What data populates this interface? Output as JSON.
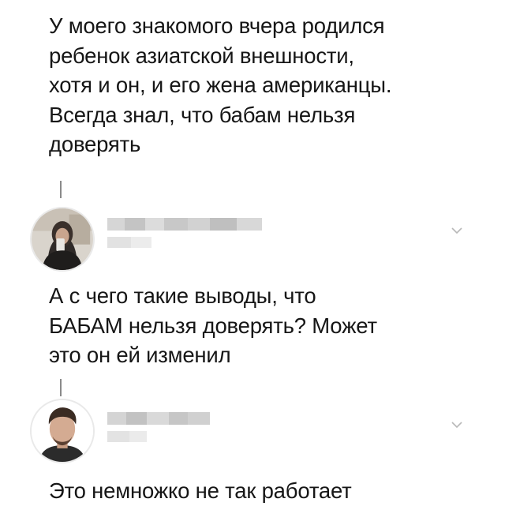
{
  "thread": {
    "original": {
      "text": "У моего знакомого вчера родился\nребенок азиатской внешности,\nхотя и он, и его жена американцы.\nВсегда знал, что бабам нельзя\nдоверять"
    },
    "reply1": {
      "avatar_icon": "user-avatar-woman",
      "text": "А с чего такие выводы, что\nБАБАМ нельзя доверять? Может\nэто он ей изменил"
    },
    "reply2": {
      "avatar_icon": "user-avatar-man",
      "text": "Это немножко не так работает"
    }
  },
  "icons": {
    "menu": "chevron-down-icon"
  },
  "colors": {
    "text": "#161616",
    "thread_line": "#8a8a8a",
    "blurred_name": "#cfcfcf",
    "chevron": "#b8b8b8"
  }
}
